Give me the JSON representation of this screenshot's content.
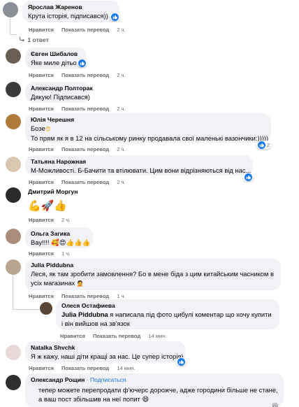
{
  "comments": [
    {
      "author": "Ярослав Жаренов",
      "text": "Крута історія, підписався))",
      "like": "Нравится",
      "translate": "Показать перевод",
      "time": "2 ч."
    },
    {
      "replies_link": "1 ответ"
    },
    {
      "author": "Євген Шибалов",
      "text": "Яке миле дітьо!",
      "like": "Нравится",
      "translate": "Показать перевод",
      "time": "2 ч."
    },
    {
      "author": "Александр Полторак",
      "text": "Дякую! Підписався)",
      "like": "Нравится",
      "translate": "Показать перевод",
      "time": "2 ч."
    },
    {
      "author": "Юлія Черешня",
      "text_line1": "Бозе",
      "text_line2": "То прям як я в 12 на сільському ринку продавала свої маленькі вазончики:)))))",
      "like": "Нравится",
      "translate": "Показать перевод",
      "time": "2 ч.",
      "reaction_count": "2"
    },
    {
      "author": "Татьяна Нарожная",
      "text": "М-Можливості. Б-Бачити та втілювати. Цим вони відрізняються від нас...",
      "like": "Нравится",
      "translate": "Показать перевод",
      "time": "2 ч."
    },
    {
      "author": "Дмитрий Моргун",
      "text": "💪🚀👍",
      "like": "Нравится",
      "time": "2 ч."
    },
    {
      "author": "Ольга Загика",
      "text": "Вау!!!! 🥰😍👍👍👍",
      "like": "Нравится",
      "time": "1 ч."
    },
    {
      "author": "Julia Piddubna",
      "text": "Леся, як там зробити замовлення? Бо в мене біда з цим китайським часником в усіх магазинах",
      "like": "Нравится",
      "translate": "Показать перевод",
      "time": "1 ч."
    },
    {
      "author": "Олеся Остафиева",
      "mention": "Julia Piddubna",
      "text": "я написала під фото цибулі коментар що хочу купити і він вийшов на зв'язок",
      "like": "Нравится",
      "translate": "Показать перевод",
      "time": "14 мин."
    },
    {
      "author": "Natalka Shvchk",
      "text": "Я ж кажу, наші діти кращі за нас. Це супер історія)",
      "like": "Нравится",
      "translate": "Показать перевод",
      "time": "14 мин."
    },
    {
      "author": "Олександр Рощин",
      "follow_sep": " · ",
      "follow": "Подписаться",
      "text": "тепер можете перепродати ф'ючерс дорожче, адже городини більше не стане, а ваш пост збільшив на неї попит 😄"
    }
  ],
  "colors": {
    "like_blue": "#1877f2",
    "bubble": "#f0f2f5",
    "meta_gray": "#65676b",
    "heart": "#f33e58"
  },
  "icons": [
    "like-icon",
    "heart-icon",
    "reply-arrow-icon"
  ]
}
